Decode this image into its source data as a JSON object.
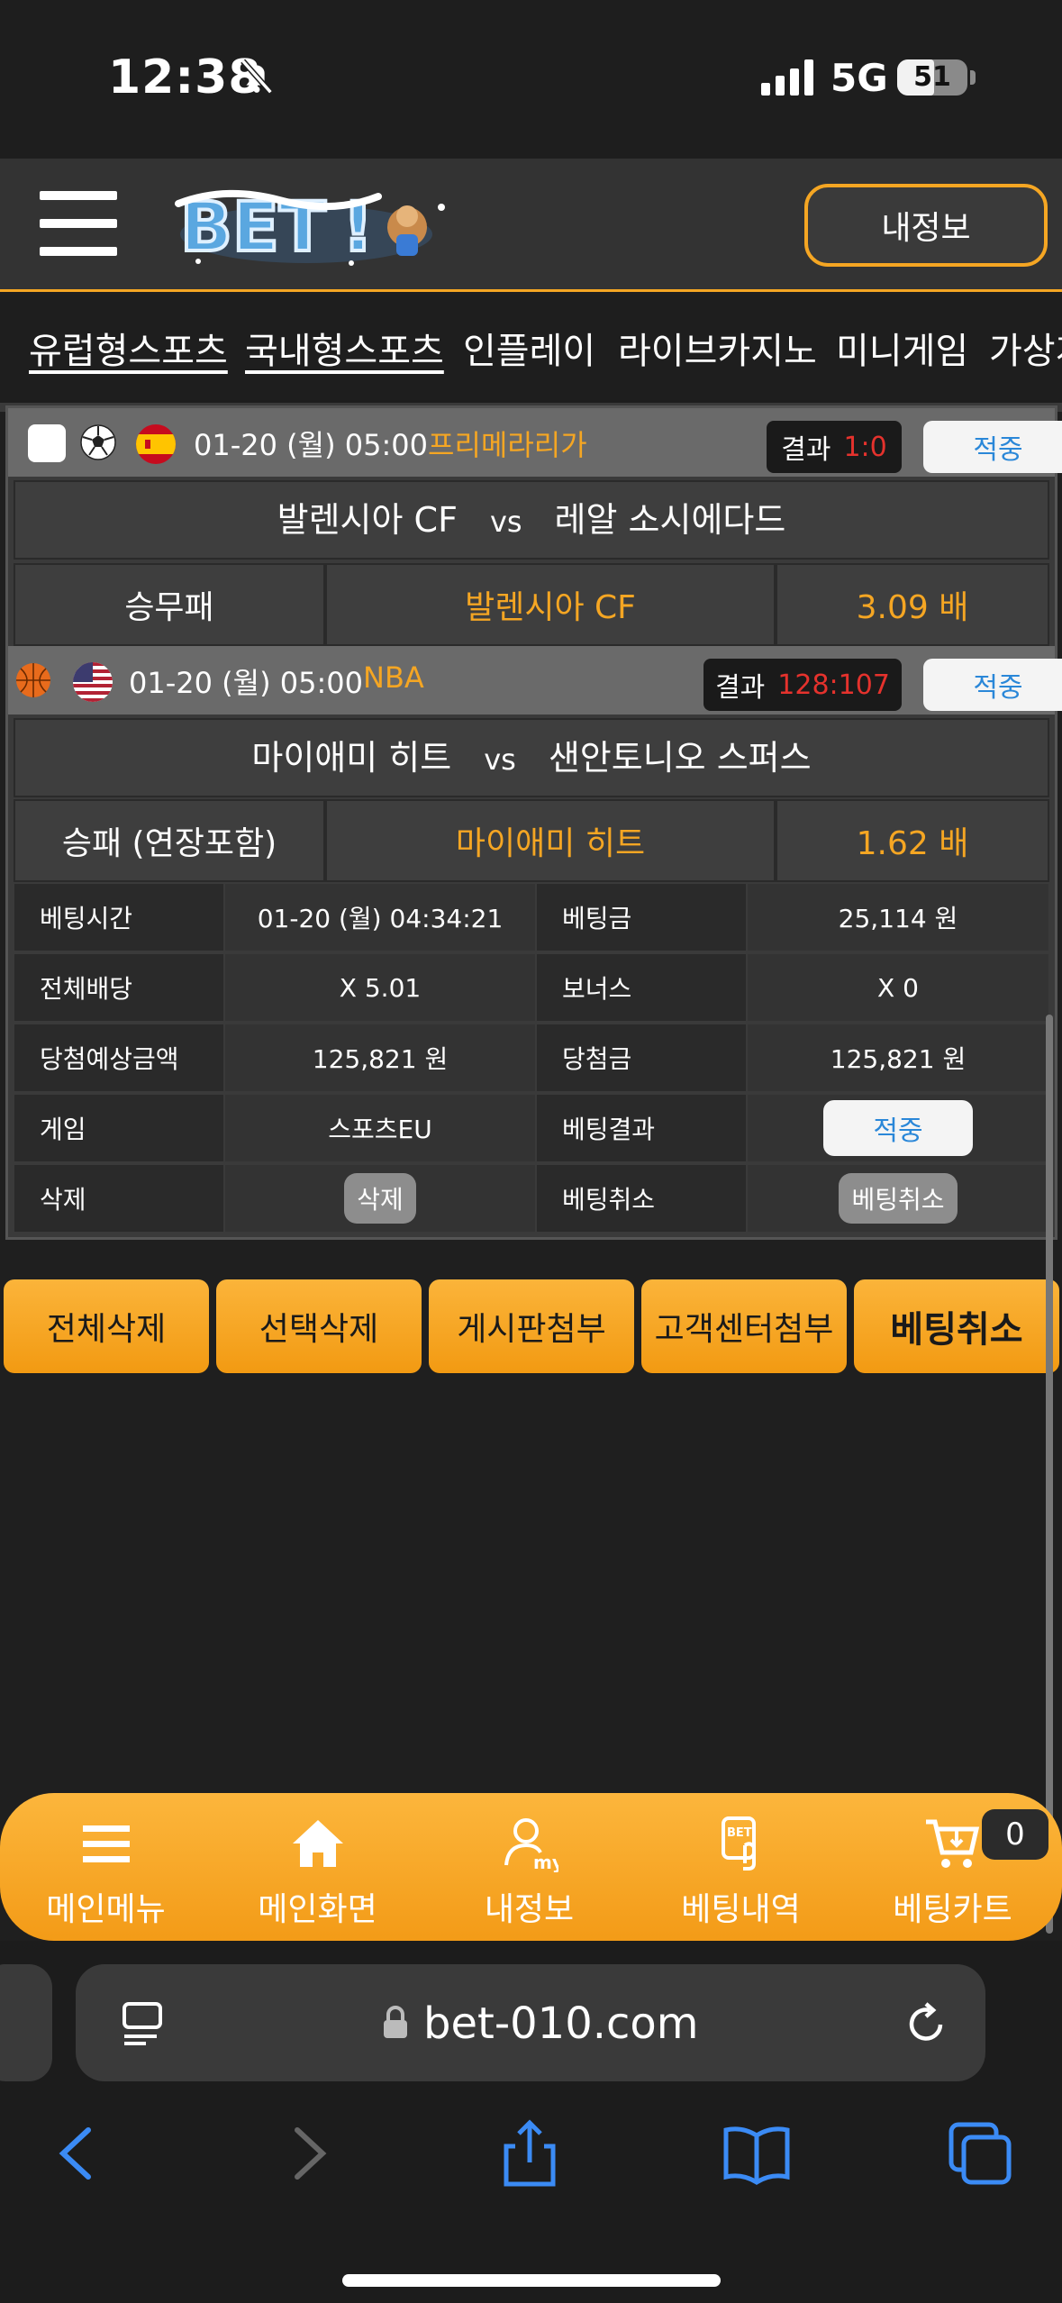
{
  "status_bar": {
    "time": "12:38",
    "network": "5G",
    "battery": "51"
  },
  "header": {
    "logo_text": "BET",
    "myinfo_label": "내정보"
  },
  "categories": [
    "유럽형스포츠",
    "국내형스포츠",
    "인플레이",
    "라이브카지노",
    "미니게임",
    "가상게"
  ],
  "bets": [
    {
      "date": "01-20 (월) 05:00",
      "league": "프리메라리가",
      "result_label": "결과",
      "result_score": "1:0",
      "status": "적중",
      "home": "발렌시아 CF",
      "vs": "vs",
      "away": "레알 소시에다드",
      "market": "승무패",
      "pick": "발렌시아 CF",
      "odds": "3.09 배"
    },
    {
      "date": "01-20 (월) 05:00",
      "league": "NBA",
      "result_label": "결과",
      "result_score": "128:107",
      "status": "적중",
      "home": "마이애미 히트",
      "vs": "vs",
      "away": "샌안토니오 스퍼스",
      "market": "승패 (연장포함)",
      "pick": "마이애미 히트",
      "odds": "1.62 배"
    }
  ],
  "details": {
    "bet_time_label": "베팅시간",
    "bet_time": "01-20 (월) 04:34:21",
    "amount_label": "베팅금",
    "amount": "25,114 원",
    "total_odds_label": "전체배당",
    "total_odds": "X 5.01",
    "bonus_label": "보너스",
    "bonus": "X 0",
    "expected_label": "당첨예상금액",
    "expected": "125,821 원",
    "won_label": "당첨금",
    "won": "125,821 원",
    "game_label": "게임",
    "game": "스포츠EU",
    "result_label": "베팅결과",
    "result": "적중",
    "delete_label": "삭제",
    "delete_btn": "삭제",
    "cancel_label": "베팅취소",
    "cancel_btn": "베팅취소"
  },
  "actions": [
    "전체삭제",
    "선택삭제",
    "게시판첨부",
    "고객센터첨부",
    "베팅취소"
  ],
  "bottom_nav": [
    {
      "label": "메인메뉴",
      "icon": "menu-icon"
    },
    {
      "label": "메인화면",
      "icon": "home-icon"
    },
    {
      "label": "내정보",
      "icon": "my-icon"
    },
    {
      "label": "베팅내역",
      "icon": "bet-history-icon"
    },
    {
      "label": "베팅카트",
      "icon": "cart-icon"
    }
  ],
  "cart_count": "0",
  "browser": {
    "url": "bet-010.com"
  },
  "colors": {
    "accent": "#f5a623",
    "result_red": "#e5322d",
    "hit_blue": "#2a87d8"
  }
}
